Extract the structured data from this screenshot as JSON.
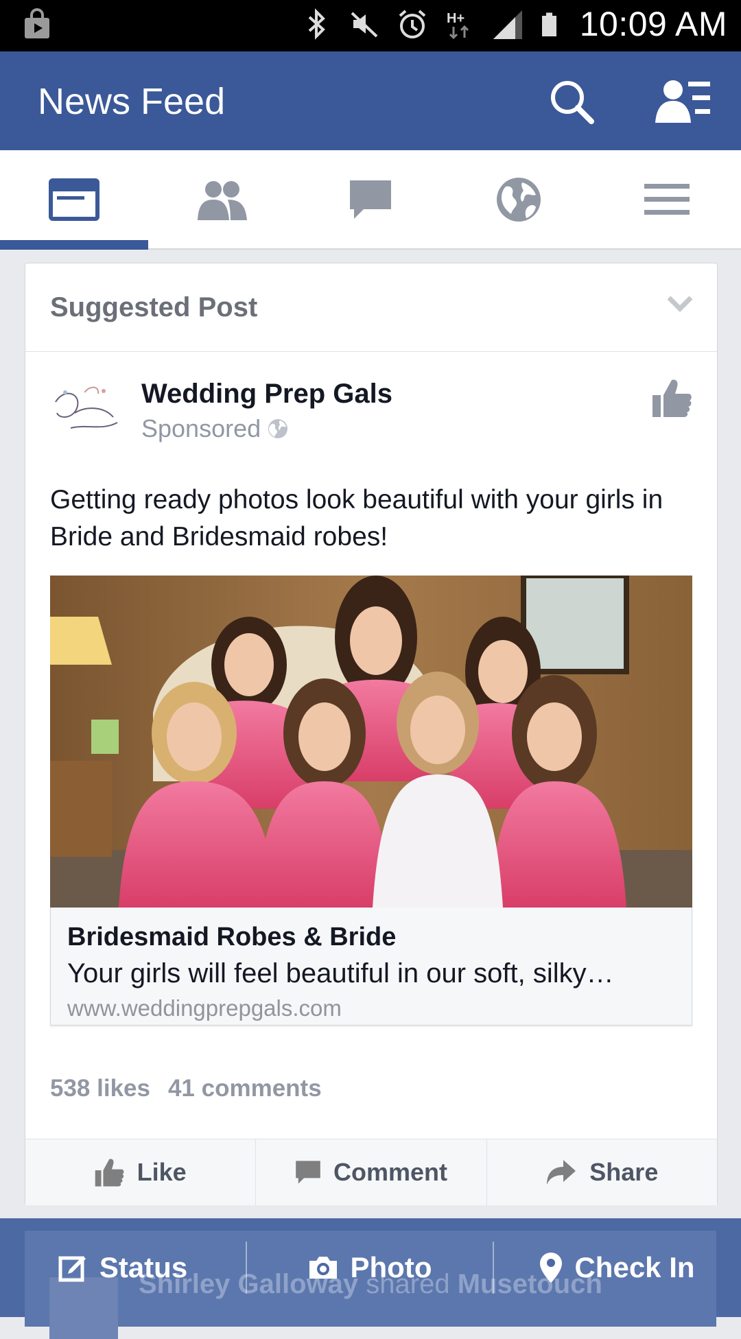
{
  "status_bar": {
    "time": "10:09 AM",
    "network": "H+"
  },
  "header": {
    "title": "News Feed"
  },
  "tabs": [
    {
      "name": "news-feed",
      "active": true
    },
    {
      "name": "friend-requests",
      "active": false
    },
    {
      "name": "messages",
      "active": false
    },
    {
      "name": "notifications",
      "active": false
    },
    {
      "name": "more",
      "active": false
    }
  ],
  "post": {
    "header_label": "Suggested Post",
    "page_name": "Wedding Prep Gals",
    "sponsored_label": "Sponsored",
    "text": "Getting ready photos look beautiful with your girls in Bride and Bridesmaid robes!",
    "link": {
      "title": "Bridesmaid Robes & Bride",
      "description": "Your girls will feel beautiful in our soft, silky…",
      "url": "www.weddingprepgals.com"
    },
    "likes": "538 likes",
    "comments": "41 comments",
    "actions": {
      "like": "Like",
      "comment": "Comment",
      "share": "Share"
    }
  },
  "background_story": {
    "author": "Shirley Galloway",
    "verb": "shared",
    "target": "Musetouch"
  },
  "composer": {
    "status": "Status",
    "photo": "Photo",
    "check_in": "Check In"
  },
  "colors": {
    "brand": "#3b5998",
    "robe_pink": "#e84f7a",
    "text_grey": "#9197a3"
  }
}
